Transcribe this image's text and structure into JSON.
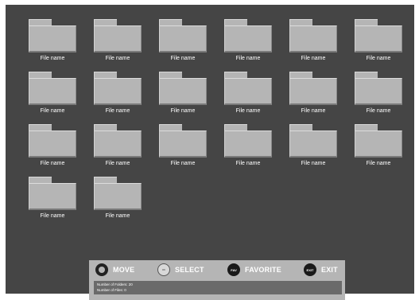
{
  "grid": {
    "folders": [
      {
        "name": "File name"
      },
      {
        "name": "File name"
      },
      {
        "name": "File name"
      },
      {
        "name": "File name"
      },
      {
        "name": "File name"
      },
      {
        "name": "File name"
      },
      {
        "name": "File name"
      },
      {
        "name": "File name"
      },
      {
        "name": "File name"
      },
      {
        "name": "File name"
      },
      {
        "name": "File name"
      },
      {
        "name": "File name"
      },
      {
        "name": "File name"
      },
      {
        "name": "File name"
      },
      {
        "name": "File name"
      },
      {
        "name": "File name"
      },
      {
        "name": "File name"
      },
      {
        "name": "File name"
      },
      {
        "name": "File name"
      },
      {
        "name": "File name"
      }
    ]
  },
  "controls": {
    "move": {
      "label": "MOVE",
      "icon": "dpad-ring-icon"
    },
    "select": {
      "label": "SELECT",
      "icon": "ok-button-icon",
      "badge_text": "OK"
    },
    "favorite": {
      "label": "FAVORITE",
      "icon": "fav-button-icon",
      "badge_text": "FAV"
    },
    "exit": {
      "label": "EXIT",
      "icon": "exit-button-icon",
      "badge_text": "EXIT"
    }
  },
  "info": {
    "folders_line": "Number of Folders: 20",
    "files_line": "Number of Files: 0"
  },
  "colors": {
    "screen_bg": "#454545",
    "folder_fill": "#b5b5b5",
    "bar_bg": "#b5b5b5",
    "info_bg": "#6a6a6a"
  }
}
